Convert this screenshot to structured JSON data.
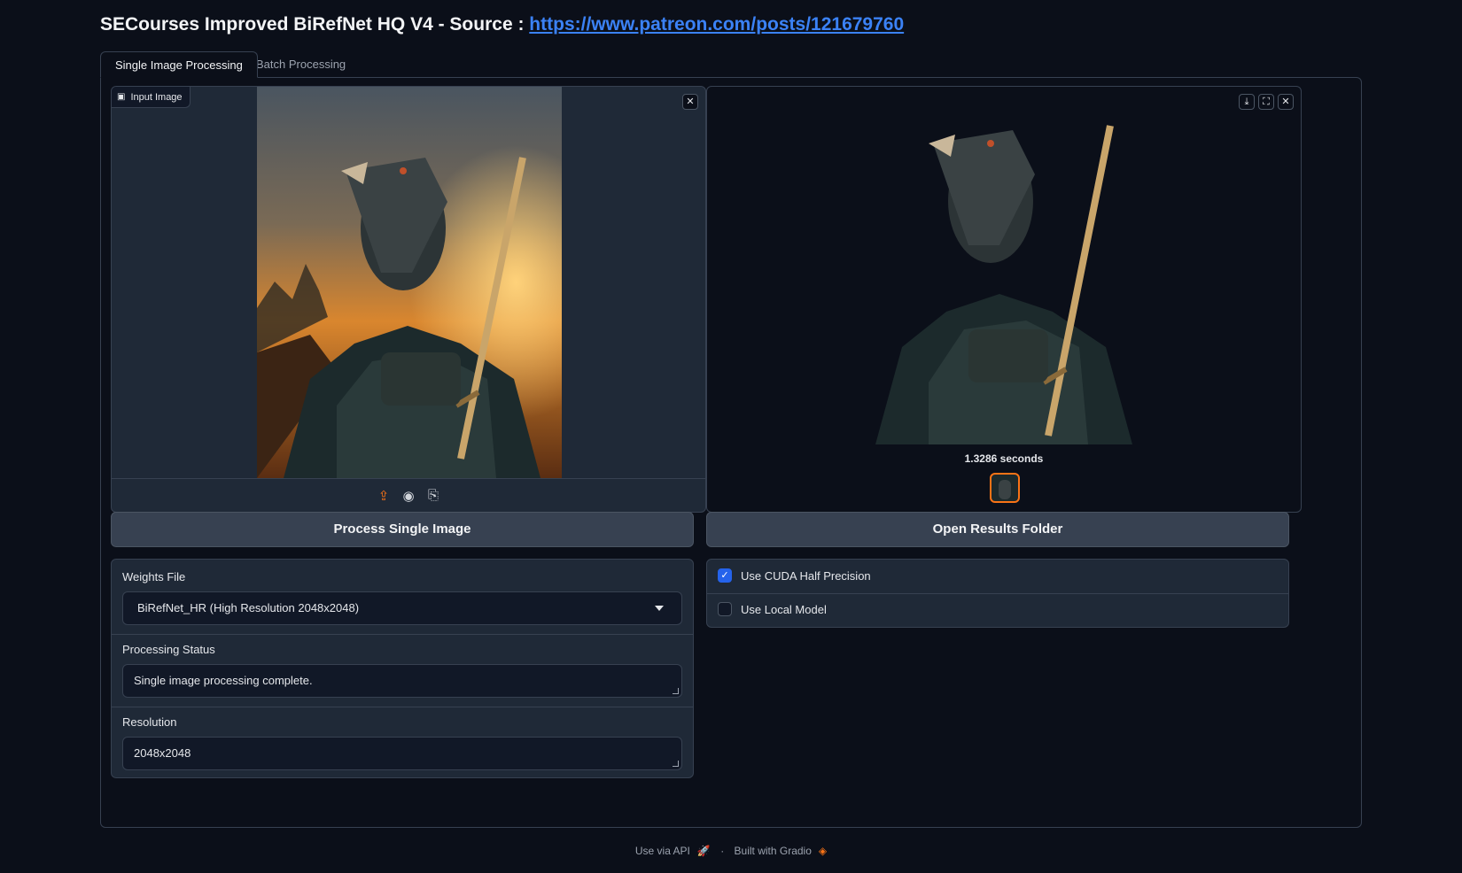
{
  "header": {
    "title": "SECourses Improved BiRefNet HQ V4 - Source : ",
    "link_text": "https://www.patreon.com/posts/121679760"
  },
  "tabs": [
    {
      "label": "Single Image Processing",
      "active": true
    },
    {
      "label": "Batch Processing",
      "active": false
    }
  ],
  "input_image": {
    "label": "Input Image",
    "image_description": "anthropomorphic badger warrior in ornate armor holding a sword, sunset and rain background"
  },
  "output_image": {
    "caption": "1.3286 seconds"
  },
  "buttons": {
    "process": "Process Single Image",
    "open_folder": "Open Results Folder"
  },
  "weights": {
    "label": "Weights File",
    "value": "BiRefNet_HR (High Resolution 2048x2048)"
  },
  "status": {
    "label": "Processing Status",
    "value": "Single image processing complete."
  },
  "resolution": {
    "label": "Resolution",
    "value": "2048x2048"
  },
  "options": {
    "cuda_half": {
      "label": "Use CUDA Half Precision",
      "checked": true
    },
    "local_model": {
      "label": "Use Local Model",
      "checked": false
    }
  },
  "footer": {
    "api": "Use via API",
    "separator": "·",
    "built": "Built with Gradio"
  },
  "colors": {
    "background": "#0b0f19",
    "panel": "#1f2937",
    "accent": "#f97316",
    "link": "#3b82f6",
    "checkbox": "#2563eb"
  }
}
